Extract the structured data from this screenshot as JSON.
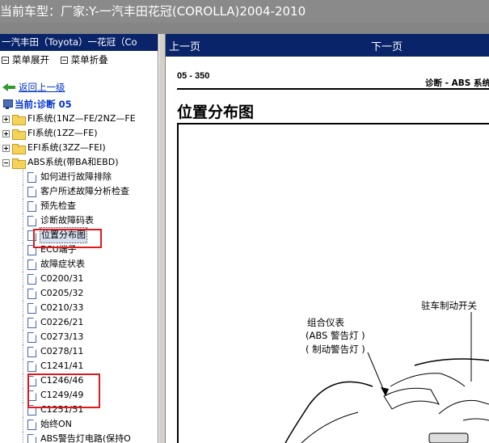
{
  "window": {
    "title": "当前车型：厂家:Y-一汽丰田花冠(COROLLA)2004-2010"
  },
  "left_panel": {
    "header": "一汽丰田（Toyota）一花冠（Co",
    "menu_expand": "菜单展开",
    "menu_collapse": "菜单折叠",
    "back_link": "返回上一级",
    "current_label": "当前:诊断  05",
    "folders": [
      {
        "label": "FI系统(1NZ—FE/2NZ—FE",
        "expanded": false
      },
      {
        "label": "FI系统(1ZZ—FE)",
        "expanded": false
      },
      {
        "label": "EFI系统(3ZZ—FEI)",
        "expanded": false
      },
      {
        "label": "ABS系统(带BA和EBD)",
        "expanded": true
      }
    ],
    "children": [
      "如何进行故障排除",
      "客户所述故障分析检查",
      "预先检查",
      "诊断故障码表",
      "位置分布图",
      "ECU端子",
      "故障症状表",
      "C0200/31",
      "C0205/32",
      "C0210/33",
      "C0226/21",
      "C0273/13",
      "C0278/11",
      "C1241/41",
      "C1246/46",
      "C1249/49",
      "C1251/51",
      "始终ON",
      "ABS警告灯电路(保持O"
    ],
    "selected_index": 4
  },
  "right_panel": {
    "prev_label": "上一页",
    "next_label": "下一页",
    "page_number": "05 - 350",
    "section": "诊断    -   ABS 系统",
    "heading": "位置分布图",
    "labels": {
      "parking_brake_switch": "驻车制动开关",
      "combination_meter": "组合仪表",
      "abs_warning": "(ABS 警告灯 )",
      "brake_warning": "( 制动警告灯 )"
    }
  },
  "colors": {
    "titlebar": "#8a8a8a",
    "panel_header": "#0a246a",
    "link": "#0033cc",
    "highlight_box": "#e0191c"
  }
}
